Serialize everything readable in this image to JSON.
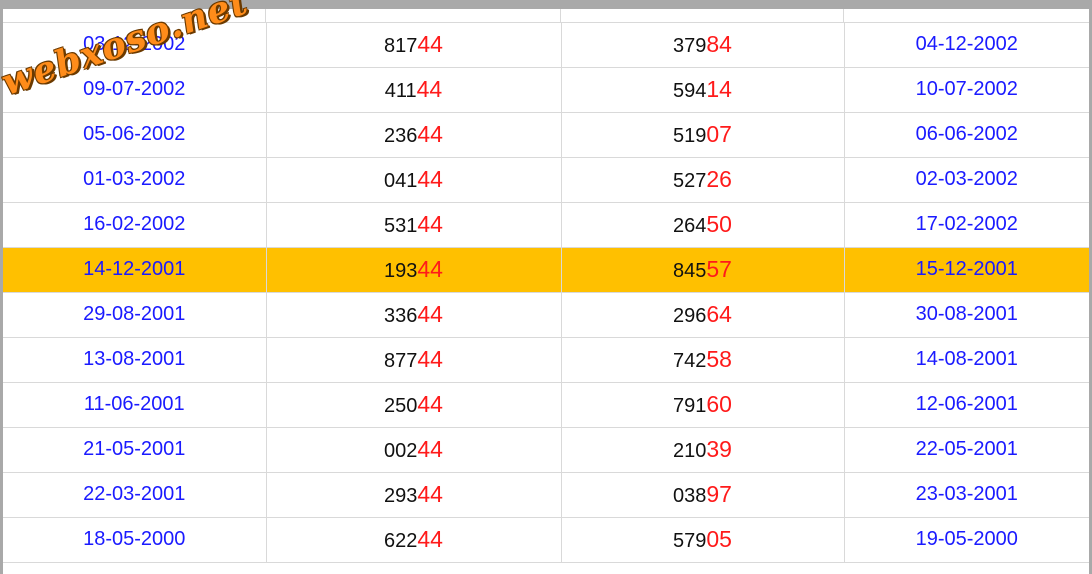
{
  "watermark": "webxoso.net",
  "columns": [
    "date",
    "number",
    "next_number",
    "next_date"
  ],
  "rows": [
    {
      "date": "03-12-2002",
      "num_prefix": "817",
      "num_suffix": "44",
      "next_prefix": "379",
      "next_suffix": "84",
      "next_date": "04-12-2002",
      "highlighted": false
    },
    {
      "date": "09-07-2002",
      "num_prefix": "411",
      "num_suffix": "44",
      "next_prefix": "594",
      "next_suffix": "14",
      "next_date": "10-07-2002",
      "highlighted": false
    },
    {
      "date": "05-06-2002",
      "num_prefix": "236",
      "num_suffix": "44",
      "next_prefix": "519",
      "next_suffix": "07",
      "next_date": "06-06-2002",
      "highlighted": false
    },
    {
      "date": "01-03-2002",
      "num_prefix": "041",
      "num_suffix": "44",
      "next_prefix": "527",
      "next_suffix": "26",
      "next_date": "02-03-2002",
      "highlighted": false
    },
    {
      "date": "16-02-2002",
      "num_prefix": "531",
      "num_suffix": "44",
      "next_prefix": "264",
      "next_suffix": "50",
      "next_date": "17-02-2002",
      "highlighted": false
    },
    {
      "date": "14-12-2001",
      "num_prefix": "193",
      "num_suffix": "44",
      "next_prefix": "845",
      "next_suffix": "57",
      "next_date": "15-12-2001",
      "highlighted": true
    },
    {
      "date": "29-08-2001",
      "num_prefix": "336",
      "num_suffix": "44",
      "next_prefix": "296",
      "next_suffix": "64",
      "next_date": "30-08-2001",
      "highlighted": false
    },
    {
      "date": "13-08-2001",
      "num_prefix": "877",
      "num_suffix": "44",
      "next_prefix": "742",
      "next_suffix": "58",
      "next_date": "14-08-2001",
      "highlighted": false
    },
    {
      "date": "11-06-2001",
      "num_prefix": "250",
      "num_suffix": "44",
      "next_prefix": "791",
      "next_suffix": "60",
      "next_date": "12-06-2001",
      "highlighted": false
    },
    {
      "date": "21-05-2001",
      "num_prefix": "002",
      "num_suffix": "44",
      "next_prefix": "210",
      "next_suffix": "39",
      "next_date": "22-05-2001",
      "highlighted": false
    },
    {
      "date": "22-03-2001",
      "num_prefix": "293",
      "num_suffix": "44",
      "next_prefix": "038",
      "next_suffix": "97",
      "next_date": "23-03-2001",
      "highlighted": false
    },
    {
      "date": "18-05-2000",
      "num_prefix": "622",
      "num_suffix": "44",
      "next_prefix": "579",
      "next_suffix": "05",
      "next_date": "19-05-2000",
      "highlighted": false
    }
  ],
  "colors": {
    "date": "#1a1aff",
    "digits": "#111111",
    "suffix": "#ff1a1a",
    "highlight": "#ffc000",
    "border": "#d9d9d9",
    "frame": "#a9a9a9",
    "watermark": "#ff8c1a"
  }
}
